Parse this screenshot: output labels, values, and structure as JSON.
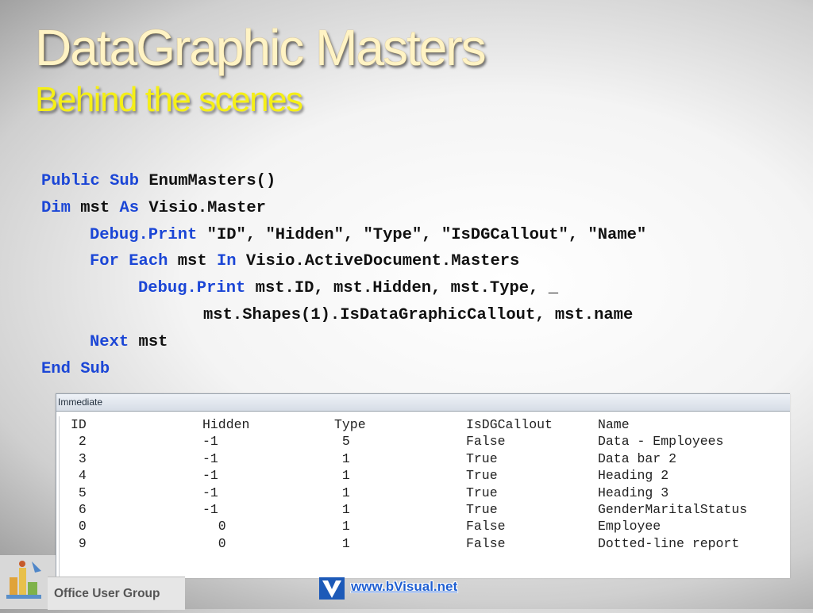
{
  "slide": {
    "title": "DataGraphic Masters",
    "subtitle": "Behind the scenes"
  },
  "code": {
    "line1": {
      "kw1": "Public",
      "kw2": "Sub",
      "text": "EnumMasters()"
    },
    "line2": {
      "kw1": "Dim",
      "text1": "mst",
      "kw2": "As",
      "text2": "Visio.Master"
    },
    "line3": {
      "kw": "Debug.Print",
      "text": "\"ID\", \"Hidden\", \"Type\", \"IsDGCallout\", \"Name\""
    },
    "line4": {
      "kw1": "For",
      "kw2": "Each",
      "text1": "mst",
      "kw3": "In",
      "text2": "Visio.ActiveDocument.Masters"
    },
    "line5": {
      "kw": "Debug.Print",
      "text": "mst.ID, mst.Hidden, mst.Type, _"
    },
    "line6": {
      "text": "mst.Shapes(1).IsDataGraphicCallout, mst.name"
    },
    "line7": {
      "kw": "Next",
      "text": "mst"
    },
    "line8": {
      "kw1": "End",
      "kw2": "Sub"
    }
  },
  "immediate": {
    "title": "Immediate",
    "headers": [
      "ID",
      "Hidden",
      "Type",
      "IsDGCallout",
      "Name"
    ],
    "rows": [
      [
        " 2",
        "-1",
        " 5",
        "False",
        "Data - Employees"
      ],
      [
        " 3",
        "-1",
        " 1",
        "True",
        "Data bar 2"
      ],
      [
        " 4",
        "-1",
        " 1",
        "True",
        "Heading 2"
      ],
      [
        " 5",
        "-1",
        " 1",
        "True",
        "Heading 3"
      ],
      [
        " 6",
        "-1",
        " 1",
        "True",
        "GenderMaritalStatus"
      ],
      [
        " 0",
        "  0",
        " 1",
        "False",
        "Employee"
      ],
      [
        " 9",
        "  0",
        " 1",
        "False",
        "Dotted-line report"
      ]
    ]
  },
  "footer": {
    "group_name": "Office User Group",
    "website": "www.bVisual.net",
    "logo_icon": "office-user-group-logo-icon",
    "brand_icon": "bvisual-v-logo-icon"
  },
  "colors": {
    "keyword": "#1b46d6",
    "title": "#fff3c4",
    "subtitle": "#f5ef16",
    "link": "#1f5fd1"
  }
}
